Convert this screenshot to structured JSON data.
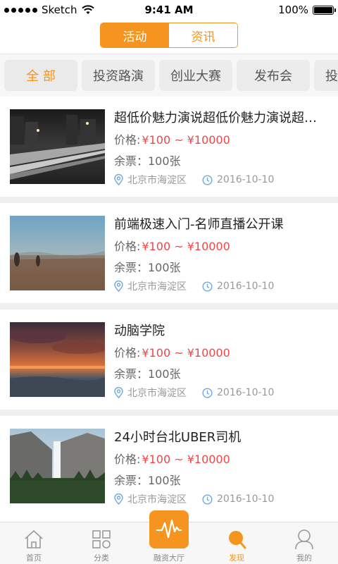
{
  "status_bar": {
    "carrier": "Sketch",
    "time": "9:41 AM",
    "battery": "100%"
  },
  "segment": {
    "tabs": [
      {
        "label": "活动",
        "active": true
      },
      {
        "label": "资讯",
        "active": false
      }
    ]
  },
  "categories": [
    {
      "label": "全 部",
      "active": true
    },
    {
      "label": "投资路演",
      "active": false
    },
    {
      "label": "创业大赛",
      "active": false
    },
    {
      "label": "发布会",
      "active": false
    },
    {
      "label": "投",
      "active": false
    }
  ],
  "events": [
    {
      "title": "超低价魅力演说超低价魅力演说超低价魅力演说",
      "price_label": "价格:",
      "price_value": "¥100 ~ ¥10000",
      "stock": "余票：100张",
      "location": "北京市海淀区",
      "date": "2016-10-10"
    },
    {
      "title": "前端极速入门-名师直播公开课",
      "price_label": "价格:",
      "price_value": "¥100 ~ ¥10000",
      "stock": "余票：100张",
      "location": "北京市海淀区",
      "date": "2016-10-10"
    },
    {
      "title": "动脑学院",
      "price_label": "价格:",
      "price_value": "¥100 ~ ¥10000",
      "stock": "余票：100张",
      "location": "北京市海淀区",
      "date": "2016-10-10"
    },
    {
      "title": "24小时台北UBER司机",
      "price_label": "价格:",
      "price_value": "¥100 ~ ¥10000",
      "stock": "余票：100张",
      "location": "北京市海淀区",
      "date": "2016-10-10"
    }
  ],
  "tabbar": {
    "items": [
      {
        "label": "首页",
        "icon": "home-icon"
      },
      {
        "label": "分类",
        "icon": "grid-icon"
      },
      {
        "label": "融资大厅",
        "icon": "pulse-icon"
      },
      {
        "label": "发现",
        "icon": "discover-icon",
        "active": true
      },
      {
        "label": "我的",
        "icon": "user-icon"
      }
    ]
  },
  "colors": {
    "accent": "#f5941e",
    "price": "#f04848"
  }
}
